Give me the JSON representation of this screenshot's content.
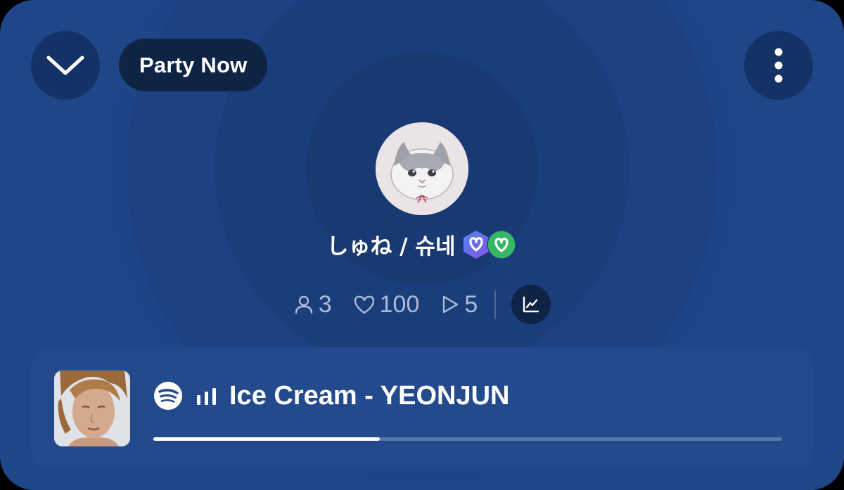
{
  "header": {
    "party_label": "Party Now"
  },
  "profile": {
    "username": "しゅね / 슈네",
    "badges": [
      "hexagon-heart-badge",
      "circle-heart-badge"
    ]
  },
  "stats": {
    "listeners": "3",
    "likes": "100",
    "plays": "5"
  },
  "now_playing": {
    "service": "spotify-icon",
    "track": "Ice Cream - YEONJUN",
    "progress": 0.36
  },
  "colors": {
    "background": "#1e4689",
    "pill": "#0f2345",
    "card": "#234a8d",
    "stat_text": "#aebbd6",
    "badge_blue": "#4f78f0",
    "badge_purple": "#8b55e6",
    "badge_green": "#35b865"
  }
}
